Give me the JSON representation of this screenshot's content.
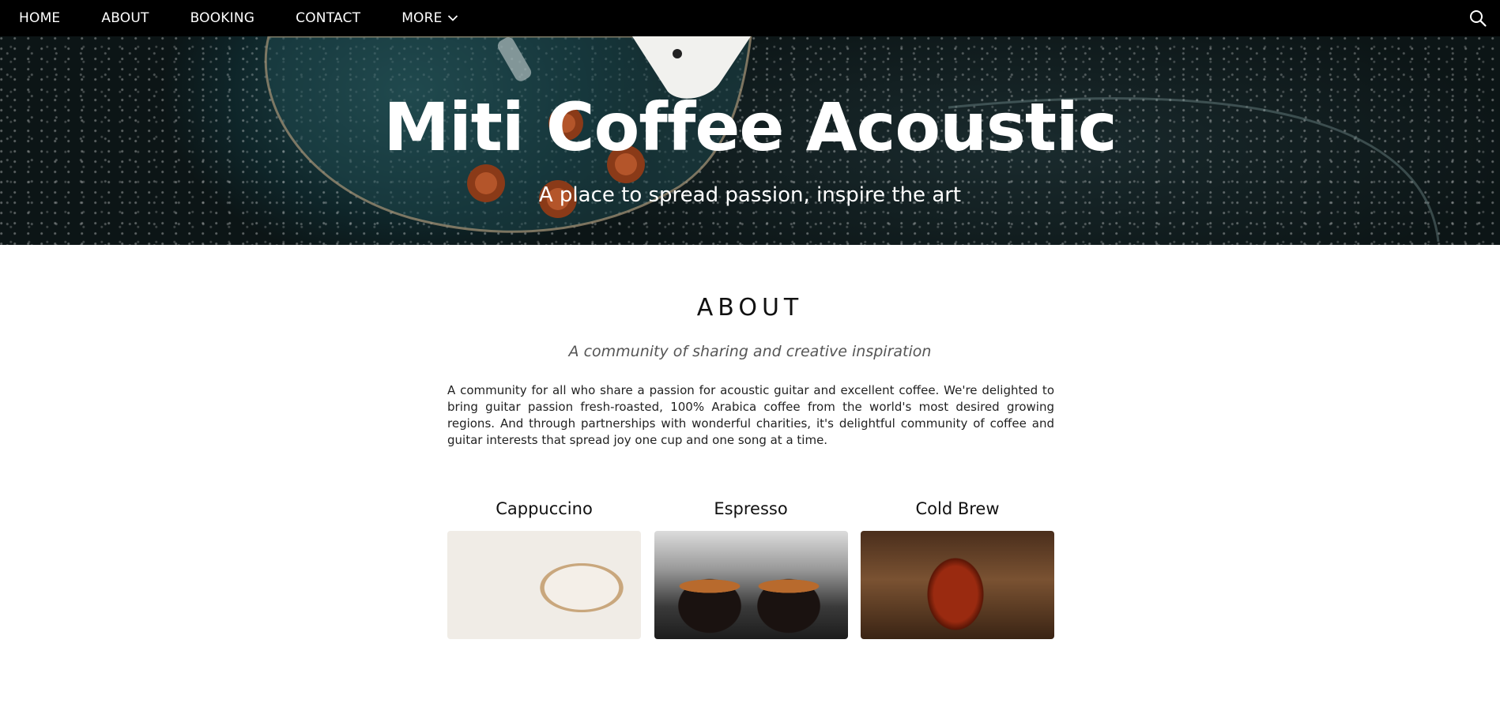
{
  "nav": {
    "items": [
      {
        "label": "HOME"
      },
      {
        "label": "ABOUT"
      },
      {
        "label": "BOOKING"
      },
      {
        "label": "CONTACT"
      },
      {
        "label": "MORE"
      }
    ],
    "more_icon": "chevron-down-icon",
    "search_icon": "search-icon"
  },
  "hero": {
    "title": "Miti Coffee Acoustic",
    "subtitle": "A place to spread passion, inspire the art"
  },
  "about": {
    "heading": "ABOUT",
    "tagline": "A community of sharing and creative inspiration",
    "body": "A community for all who share a passion for acoustic guitar and excellent coffee. We're delighted to bring guitar passion fresh-roasted, 100% Arabica coffee from the world's most desired growing regions. And through partnerships with wonderful charities, it's delightful community of coffee and guitar interests that spread joy one cup and one song at a time."
  },
  "products": [
    {
      "name": "Cappuccino"
    },
    {
      "name": "Espresso"
    },
    {
      "name": "Cold Brew"
    }
  ],
  "colors": {
    "nav_bg": "#000000",
    "nav_text": "#ffffff",
    "hero_bg": "#0d1618",
    "page_bg": "#ffffff"
  }
}
